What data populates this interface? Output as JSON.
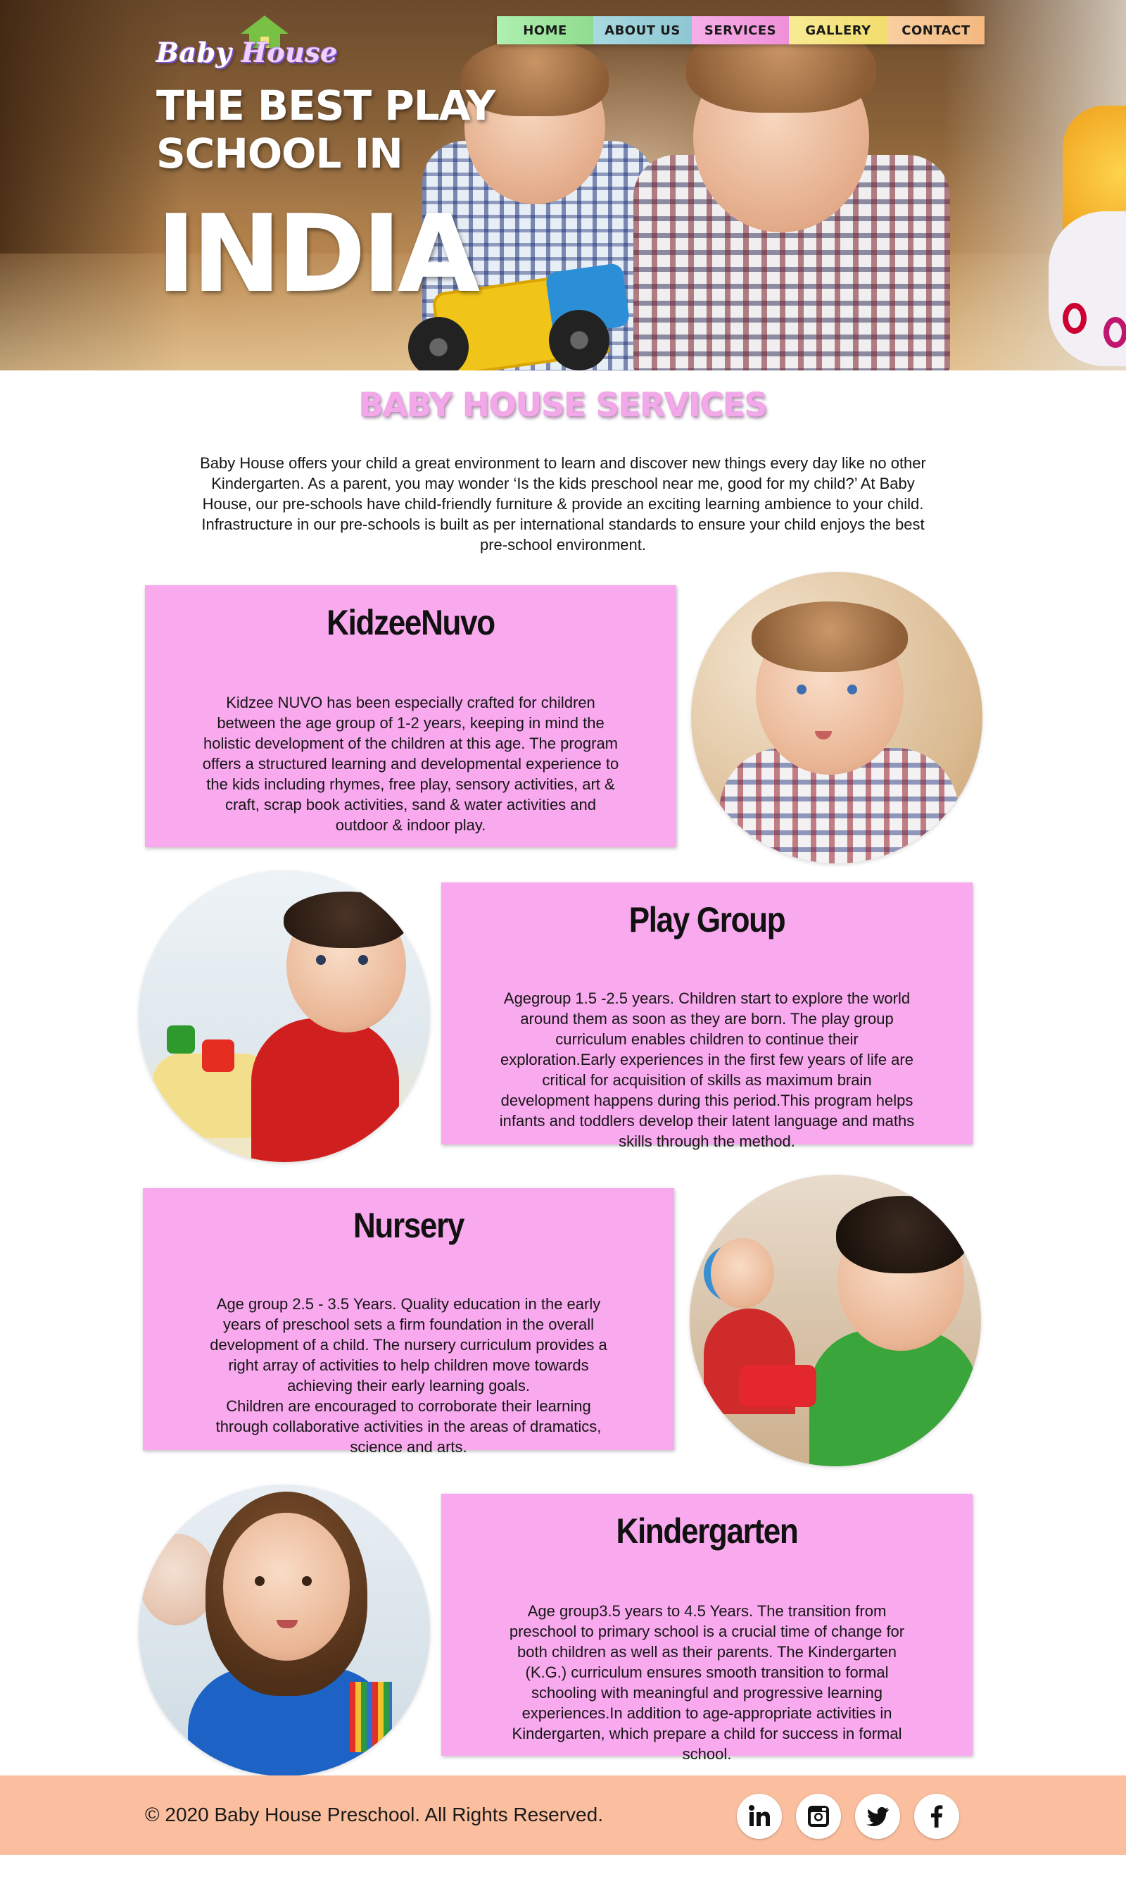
{
  "brand": {
    "logo_text_1": "Baby",
    "logo_text_2": "House"
  },
  "nav": {
    "items": [
      {
        "label": "HOME",
        "color": "#9ee69f"
      },
      {
        "label": "ABOUT US",
        "color": "#9ccfd9"
      },
      {
        "label": "SERVICES",
        "color": "#f49ee1"
      },
      {
        "label": "GALLERY",
        "color": "#f5e381"
      },
      {
        "label": "CONTACT",
        "color": "#f6c38f"
      }
    ]
  },
  "hero": {
    "line1": "THE BEST PLAY",
    "line2": "SCHOOL IN",
    "line3": "INDIA"
  },
  "services": {
    "title": "BABY HOUSE SERVICES",
    "intro": "Baby House offers your child a great environment to learn and discover new things every day like no other Kindergarten. As a parent, you may wonder ‘Is the kids preschool near me, good for my child?’ At Baby House, our pre-schools have child-friendly furniture & provide an exciting learning ambience to your child. Infrastructure in our pre-schools is built as per international standards to ensure your child enjoys the best pre-school environment.",
    "cards": [
      {
        "title": "KidzeeNuvo",
        "text": "Kidzee NUVO has been especially crafted for children between the age group of 1-2 years, keeping in mind the holistic development of the children at this age. The program offers a structured learning and developmental experience to the kids including rhymes, free play, sensory activities, art & craft, scrap book activities, sand & water activities and outdoor & indoor play."
      },
      {
        "title": "Play Group",
        "text": "Agegroup 1.5 -2.5 years. Children start to explore the world around them as soon as they are born. The play group curriculum enables children to continue their exploration.Early experiences in the first few years of life are critical for acquisition of skills as maximum brain development happens during this period.This program helps infants and toddlers develop their latent language and maths skills through the method."
      },
      {
        "title": "Nursery",
        "text": "Age group 2.5 - 3.5 Years. Quality education in the early years of preschool sets a firm foundation in the overall development of a child. The nursery curriculum provides a right array of activities to help children move towards achieving their early learning goals.\nChildren are encouraged to corroborate their learning through collaborative activities in the areas of dramatics, science and arts."
      },
      {
        "title": "Kindergarten",
        "text": "Age group3.5 years to 4.5 Years. The transition from preschool to primary school is a crucial time of change for both children as well as their parents. The Kindergarten (K.G.) curriculum ensures smooth transition to formal schooling with meaningful and progressive learning experiences.In addition to age-appropriate activities in Kindergarten, which prepare a child for success in formal school."
      }
    ]
  },
  "footer": {
    "copyright": "© 2020 Baby House Preschool. All Rights Reserved.",
    "social": [
      "linkedin-icon",
      "instagram-icon",
      "twitter-icon",
      "facebook-icon"
    ]
  },
  "colors": {
    "card_pink": "#f9a9ee",
    "title_pink": "#f3a8ea",
    "footer_peach": "#fbbf9f"
  }
}
